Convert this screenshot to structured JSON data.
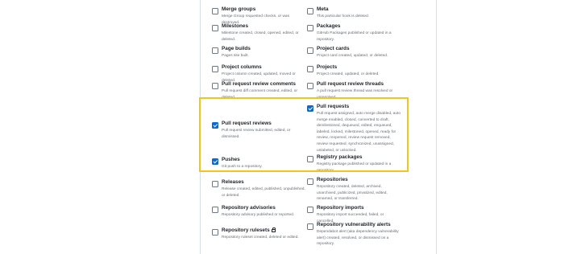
{
  "colors": {
    "highlight": "#f4c41d",
    "checked": "#0969da"
  },
  "events": [
    {
      "key": "merge_groups",
      "title": "Merge groups",
      "description": "Merge Group requested checks, or was destroyed.",
      "checked": false
    },
    {
      "key": "meta",
      "title": "Meta",
      "description": "This particular hook is deleted.",
      "checked": false
    },
    {
      "key": "milestones",
      "title": "Milestones",
      "description": "Milestone created, closed, opened, edited, or deleted.",
      "checked": false
    },
    {
      "key": "packages",
      "title": "Packages",
      "description": "GitHub Packages published or updated in a repository.",
      "checked": false
    },
    {
      "key": "page_builds",
      "title": "Page builds",
      "description": "Pages site built.",
      "checked": false
    },
    {
      "key": "project_cards",
      "title": "Project cards",
      "description": "Project card created, updated, or deleted.",
      "checked": false
    },
    {
      "key": "project_columns",
      "title": "Project columns",
      "description": "Project column created, updated, moved or deleted.",
      "checked": false
    },
    {
      "key": "projects",
      "title": "Projects",
      "description": "Project created, updated, or deleted.",
      "checked": false
    },
    {
      "key": "pr_review_comments",
      "title": "Pull request review comments",
      "description": "Pull request diff comment created, edited, or deleted.",
      "checked": false
    },
    {
      "key": "pr_review_threads",
      "title": "Pull request review threads",
      "description": "A pull request review thread was resolved or unresolved.",
      "checked": false
    },
    {
      "key": "pull_requests",
      "title": "Pull requests",
      "description": "Pull request assigned, auto merge disabled, auto merge enabled, closed, converted to draft, demilestoned, dequeued, edited, enqueued, labeled, locked, milestoned, opened, ready for review, reopened, review request removed, review requested, synchronized, unassigned, unlabeled, or unlocked.",
      "checked": true
    },
    {
      "key": "pr_reviews",
      "title": "Pull request reviews",
      "description": "Pull request review submitted, edited, or dismissed.",
      "checked": true
    },
    {
      "key": "pushes",
      "title": "Pushes",
      "description": "Git push to a repository.",
      "checked": true
    },
    {
      "key": "registry_packages",
      "title": "Registry packages",
      "description": "Registry package published or updated in a repository.",
      "checked": false
    },
    {
      "key": "releases",
      "title": "Releases",
      "description": "Release created, edited, published, unpublished, or deleted.",
      "checked": false
    },
    {
      "key": "repositories",
      "title": "Repositories",
      "description": "Repository created, deleted, archived, unarchived, publicized, privatized, edited, renamed, or transferred.",
      "checked": false
    },
    {
      "key": "repo_advisories",
      "title": "Repository advisories",
      "description": "Repository advisory published or reported.",
      "checked": false
    },
    {
      "key": "repo_imports",
      "title": "Repository imports",
      "description": "Repository import succeeded, failed, or cancelled.",
      "checked": false
    },
    {
      "key": "repo_rulesets",
      "title": "Repository rulesets",
      "description": "Repository ruleset created, deleted or edited.",
      "checked": false,
      "icon": "lock-icon"
    },
    {
      "key": "repo_vuln_alerts",
      "title": "Repository vulnerability alerts",
      "description": "Dependabot alert (aka dependency vulnerability alert) created, resolved, or dismissed on a repository.",
      "checked": false
    }
  ]
}
